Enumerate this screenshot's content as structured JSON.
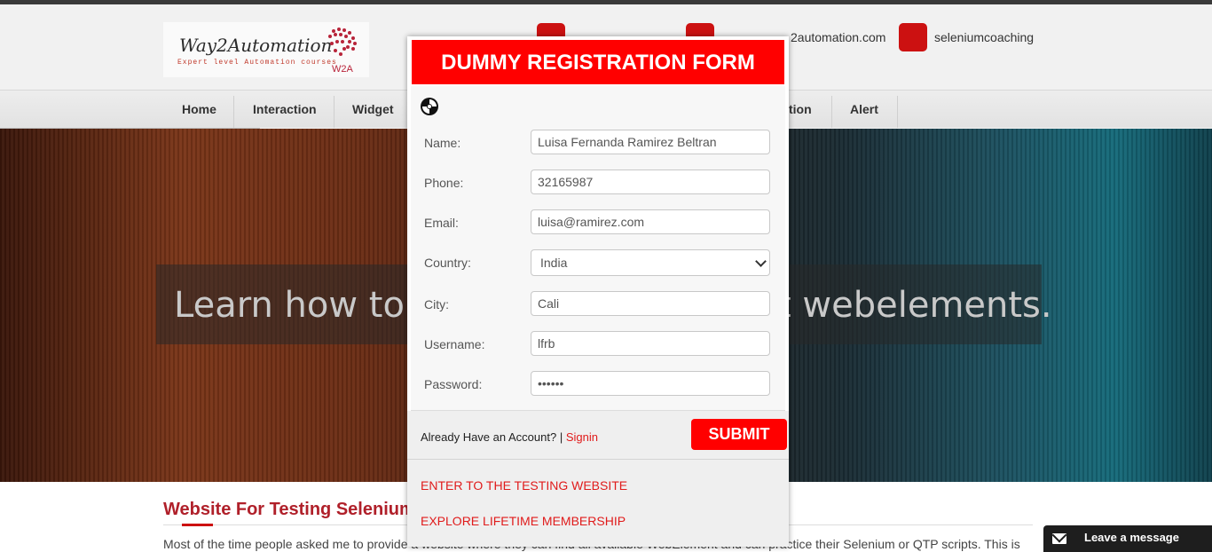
{
  "header": {
    "logo_text": "Way2Automation",
    "logo_sub": "Expert level Automation courses",
    "logo_mark": "W2A",
    "contact_email": "2automation.com",
    "contact_skype": "seleniumcoaching"
  },
  "nav": {
    "items": [
      {
        "label": "Home"
      },
      {
        "label": "Interaction"
      },
      {
        "label": "Widget"
      },
      {
        "label": "tion"
      },
      {
        "label": "Alert"
      }
    ]
  },
  "hero": {
    "left_text": "Learn how to h",
    "right_text": "t webelements."
  },
  "content": {
    "title": "Website For Testing Selenium",
    "text": "Most of the time people asked me to provide a website where they can find all available WebElement and can practice their Selenium or QTP scripts. This is"
  },
  "modal": {
    "title": "DUMMY REGISTRATION FORM",
    "fields": {
      "name": {
        "label": "Name:",
        "value": "Luisa Fernanda Ramirez Beltran"
      },
      "phone": {
        "label": "Phone:",
        "value": "32165987"
      },
      "email": {
        "label": "Email:",
        "value": "luisa@ramirez.com"
      },
      "country": {
        "label": "Country:",
        "value": "India"
      },
      "city": {
        "label": "City:",
        "value": "Cali"
      },
      "username": {
        "label": "Username:",
        "value": "lfrb"
      },
      "password": {
        "label": "Password:",
        "value": "••••••"
      }
    },
    "already_text": "Already Have an Account? |",
    "signin_label": "Signin",
    "submit_label": "SUBMIT",
    "link_testing": "ENTER TO THE TESTING WEBSITE",
    "link_membership": "EXPLORE LIFETIME MEMBERSHIP"
  },
  "chat": {
    "label": "Leave a message",
    "icon": "envelope-icon"
  },
  "colors": {
    "accent_red": "#ff0000",
    "link_red": "#e01b1b",
    "nav_bg": "#e6e6e6"
  }
}
